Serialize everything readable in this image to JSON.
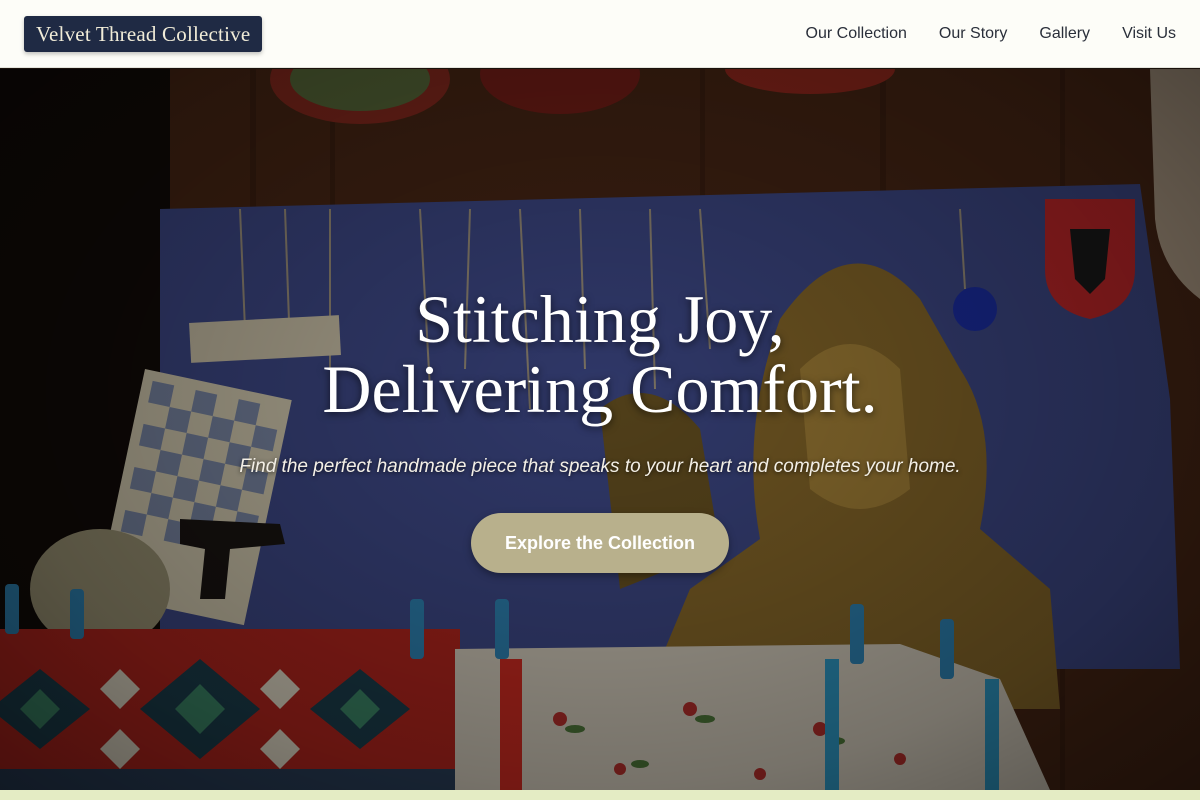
{
  "brand": {
    "name": "Velvet Thread Collective"
  },
  "nav": {
    "items": [
      {
        "label": "Our Collection"
      },
      {
        "label": "Our Story"
      },
      {
        "label": "Gallery"
      },
      {
        "label": "Visit Us"
      }
    ]
  },
  "hero": {
    "title_line1": "Stitching Joy,",
    "title_line2": "Delivering Comfort.",
    "subtitle": "Find the perfect handmade piece that speaks to your heart and completes your home.",
    "cta_label": "Explore the Collection",
    "image_icon": "market-stall-photo"
  },
  "colors": {
    "logo_bg": "#1f2a44",
    "header_bg": "#fdfdf8",
    "cta_bg": "#b8b08c",
    "footer_strip": "#e4ecc4"
  }
}
